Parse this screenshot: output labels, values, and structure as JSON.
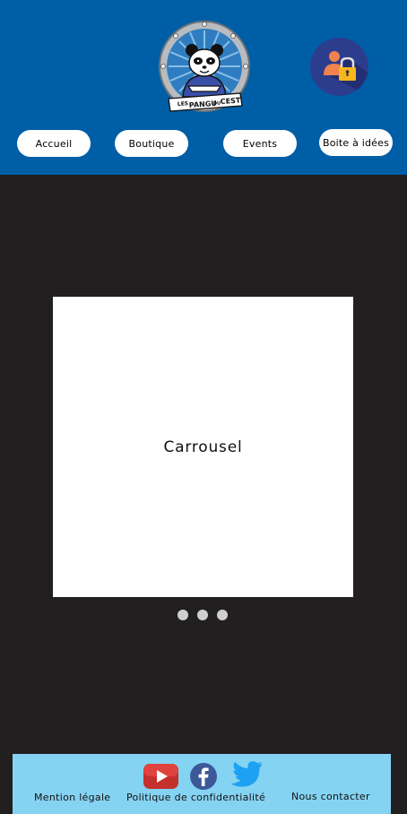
{
  "header": {
    "background": "#005ea6",
    "logo": {
      "icon": "panda-logo-icon",
      "text_top": "LES",
      "text_main": "PANGU",
      "text_small": "DU",
      "text_right": "CEST"
    },
    "login": {
      "icon": "user-lock-icon"
    }
  },
  "nav": {
    "items": [
      {
        "label": "Accueil"
      },
      {
        "label": "Boutique"
      },
      {
        "label": "Events"
      },
      {
        "label": "Boite à idées"
      }
    ]
  },
  "main": {
    "background": "#221f20",
    "carousel": {
      "label": "Carrousel",
      "slides": 3,
      "active": 1
    }
  },
  "footer": {
    "background": "#85d3f2",
    "social": [
      {
        "icon": "youtube-icon"
      },
      {
        "icon": "facebook-icon"
      },
      {
        "icon": "twitter-icon"
      }
    ],
    "links": [
      {
        "label": "Mention légale"
      },
      {
        "label": "Politique de confidentialité"
      },
      {
        "label": "Nous contacter"
      }
    ]
  }
}
